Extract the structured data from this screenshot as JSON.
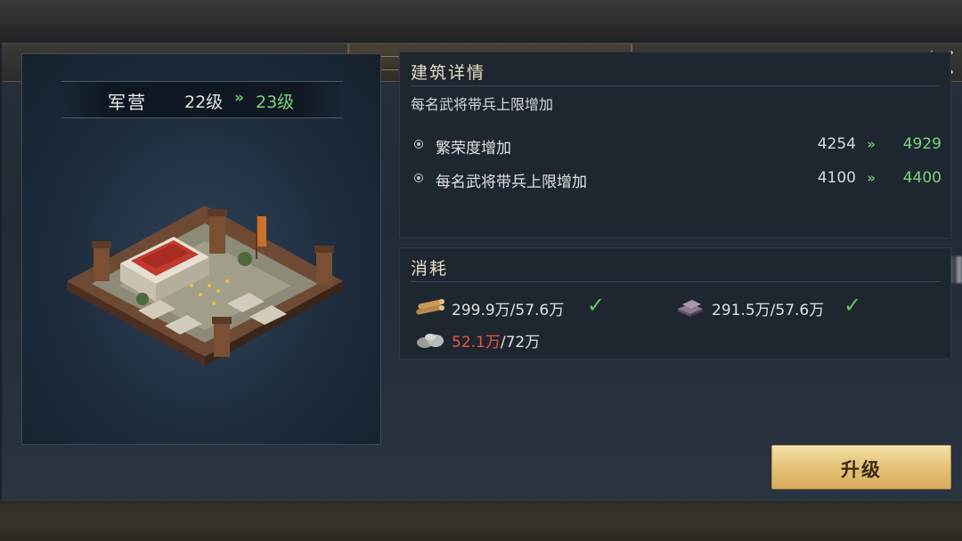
{
  "dialog": {
    "title": "升级"
  },
  "building": {
    "name": "军营",
    "level_from": "22级",
    "level_arrow": "»",
    "level_to": "23级"
  },
  "details": {
    "title": "建筑详情",
    "description": "每名武将带兵上限增加",
    "stats": [
      {
        "label": "繁荣度增加",
        "from": "4254",
        "arrow": "»",
        "to": "4929"
      },
      {
        "label": "每名武将带兵上限增加",
        "from": "4100",
        "arrow": "»",
        "to": "4400"
      }
    ]
  },
  "cost": {
    "title": "消耗",
    "items": [
      {
        "icon": "wood-icon",
        "current": "299.9万",
        "required": "/57.6万",
        "sufficient": true,
        "check": "✓"
      },
      {
        "icon": "iron-ingot-icon",
        "current": "291.5万",
        "required": "/57.6万",
        "sufficient": true,
        "check": "✓"
      },
      {
        "icon": "stone-icon",
        "current": "52.1万",
        "required": "/72万",
        "sufficient": false
      }
    ]
  },
  "actions": {
    "upgrade_label": "升级"
  },
  "colors": {
    "gain_green": "#7ad47a",
    "shortage_red": "#e8553d",
    "button_gold": "#e7c47a"
  }
}
